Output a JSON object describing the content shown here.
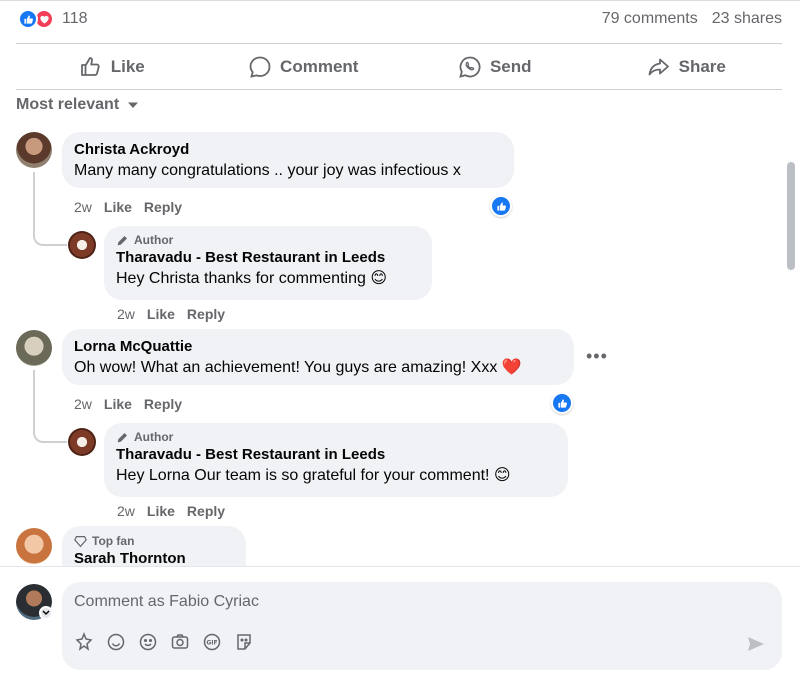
{
  "summary": {
    "reaction_count": "118",
    "comments": "79 comments",
    "shares": "23 shares"
  },
  "actions": {
    "like": "Like",
    "comment": "Comment",
    "send": "Send",
    "share": "Share"
  },
  "sort": {
    "label": "Most relevant"
  },
  "comments": [
    {
      "author": "Christa Ackroyd",
      "text": "Many many congratulations .. your joy was infectious x",
      "time": "2w",
      "like": "Like",
      "reply": "Reply",
      "reply_item": {
        "badge": "Author",
        "author": "Tharavadu - Best Restaurant in Leeds",
        "text": "Hey Christa thanks for commenting 😊",
        "time": "2w",
        "like": "Like",
        "reply": "Reply"
      }
    },
    {
      "author": "Lorna McQuattie",
      "text": "Oh wow! What an achievement! You guys are amazing! Xxx ❤️",
      "time": "2w",
      "like": "Like",
      "reply": "Reply",
      "more": "•••",
      "reply_item": {
        "badge": "Author",
        "author": "Tharavadu - Best Restaurant in Leeds",
        "text": "Hey Lorna Our team is so grateful for your comment! 😊",
        "time": "2w",
        "like": "Like",
        "reply": "Reply"
      }
    },
    {
      "badge": "Top fan",
      "author": "Sarah Thornton"
    }
  ],
  "composer": {
    "placeholder": "Comment as Fabio Cyriac"
  },
  "colors": {
    "brand_blue": "#1877f2",
    "love_red": "#f33e58",
    "muted": "#65676b",
    "bubble": "#f0f2f5"
  }
}
